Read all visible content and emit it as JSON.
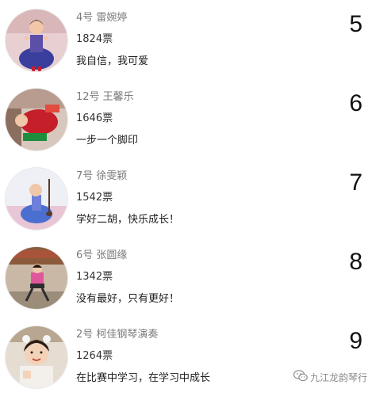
{
  "contestants": [
    {
      "name": "4号 雷婉婷",
      "votes": "1824票",
      "motto": "我自信，我可爱",
      "rank": "5"
    },
    {
      "name": "12号 王馨乐",
      "votes": "1646票",
      "motto": "一步一个脚印",
      "rank": "6"
    },
    {
      "name": "7号 徐雯颖",
      "votes": "1542票",
      "motto": "学好二胡，快乐成长！",
      "rank": "7"
    },
    {
      "name": "6号 张圆缘",
      "votes": "1342票",
      "motto": "没有最好，只有更好！",
      "rank": "8"
    },
    {
      "name": "2号 柯佳钢琴演奏",
      "votes": "1264票",
      "motto": "在比赛中学习，在学习中成长",
      "rank": "9"
    }
  ],
  "watermark": {
    "text": "九江龙韵琴行",
    "icon": "wechat-icon"
  }
}
